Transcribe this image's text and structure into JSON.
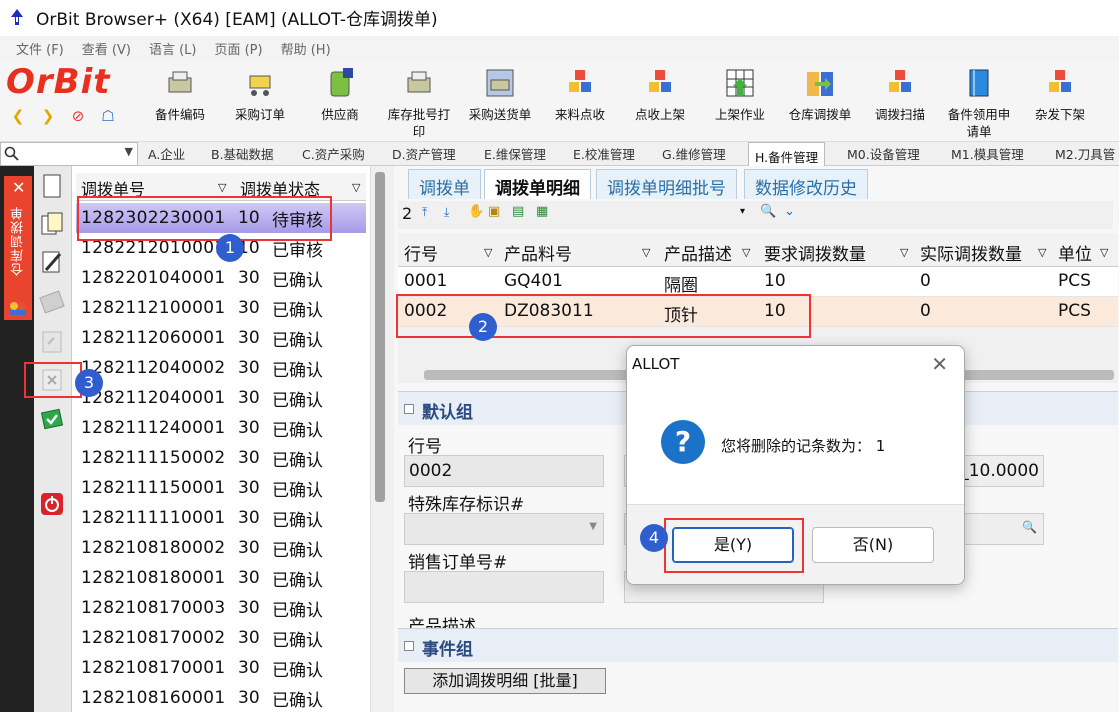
{
  "window": {
    "title": "OrBit Browser+ (X64) [EAM] (ALLOT-仓库调拨单)"
  },
  "menu": [
    "文件 (F)",
    "查看 (V)",
    "语言 (L)",
    "页面 (P)",
    "帮助 (H)"
  ],
  "brand": {
    "logo_text": "OrBit"
  },
  "toolbar": [
    {
      "label": "备件编码"
    },
    {
      "label": "采购订单"
    },
    {
      "label": "供应商"
    },
    {
      "label": "库存批号打\n印"
    },
    {
      "label": "采购送货单"
    },
    {
      "label": "来料点收"
    },
    {
      "label": "点收上架"
    },
    {
      "label": "上架作业"
    },
    {
      "label": "仓库调拨单"
    },
    {
      "label": "调拨扫描"
    },
    {
      "label": "备件领用申\n请单"
    },
    {
      "label": "杂发下架"
    }
  ],
  "module_tabs": [
    "A.企业",
    "B.基础数据",
    "C.资产采购",
    "D.资产管理",
    "E.维保管理",
    "E.校准管理",
    "G.维修管理",
    "H.备件管理",
    "M0.设备管理",
    "M1.模具管理",
    "M2.刀具管"
  ],
  "active_module_tab": "H.备件管理",
  "side_panel": {
    "label": "仓库调拨单"
  },
  "list": {
    "headers": [
      "调拨单号",
      "调拨单状态"
    ],
    "rows": [
      {
        "id": "1282302230001",
        "code": "10",
        "status": "待审核"
      },
      {
        "id": "1282212010001",
        "code": "10",
        "status": "已审核"
      },
      {
        "id": "1282201040001",
        "code": "30",
        "status": "已确认"
      },
      {
        "id": "1282112100001",
        "code": "30",
        "status": "已确认"
      },
      {
        "id": "1282112060001",
        "code": "30",
        "status": "已确认"
      },
      {
        "id": "1282112040002",
        "code": "30",
        "status": "已确认"
      },
      {
        "id": "1282112040001",
        "code": "30",
        "status": "已确认"
      },
      {
        "id": "1282111240001",
        "code": "30",
        "status": "已确认"
      },
      {
        "id": "1282111150002",
        "code": "30",
        "status": "已确认"
      },
      {
        "id": "1282111150001",
        "code": "30",
        "status": "已确认"
      },
      {
        "id": "1282111110001",
        "code": "30",
        "status": "已确认"
      },
      {
        "id": "1282108180002",
        "code": "30",
        "status": "已确认"
      },
      {
        "id": "1282108180001",
        "code": "30",
        "status": "已确认"
      },
      {
        "id": "1282108170003",
        "code": "30",
        "status": "已确认"
      },
      {
        "id": "1282108170002",
        "code": "30",
        "status": "已确认"
      },
      {
        "id": "1282108170001",
        "code": "30",
        "status": "已确认"
      },
      {
        "id": "1282108160001",
        "code": "30",
        "status": "已确认"
      }
    ]
  },
  "detail_tabs": [
    "调拨单",
    "调拨单明细",
    "调拨单明细批号",
    "数据修改历史"
  ],
  "active_detail_tab": "调拨单明细",
  "grid_toolbar": {
    "record_count": "2"
  },
  "grid": {
    "headers": [
      "行号",
      "产品料号",
      "产品描述",
      "要求调拨数量",
      "实际调拨数量",
      "单位"
    ],
    "rows": [
      [
        "0001",
        "GQ401",
        "隔圈",
        "10",
        "0",
        "PCS"
      ],
      [
        "0002",
        "DZ083011",
        "顶针",
        "10",
        "0",
        "PCS"
      ]
    ]
  },
  "form": {
    "group_default": "默认组",
    "line_no_label": "行号",
    "line_no_value": "0002",
    "special_stock_label": "特殊库存标识#",
    "sales_order_label": "销售订单号#",
    "product_desc_label": "产品描述",
    "partial_value": "_10.0000",
    "group_event": "事件组",
    "add_detail_button": "添加调拨明细 [批量]"
  },
  "dialog": {
    "title": "ALLOT",
    "message": "您将删除的记条数为：  1",
    "yes": "是(Y)",
    "no": "否(N)"
  },
  "annotations": [
    "1",
    "2",
    "3",
    "4"
  ]
}
